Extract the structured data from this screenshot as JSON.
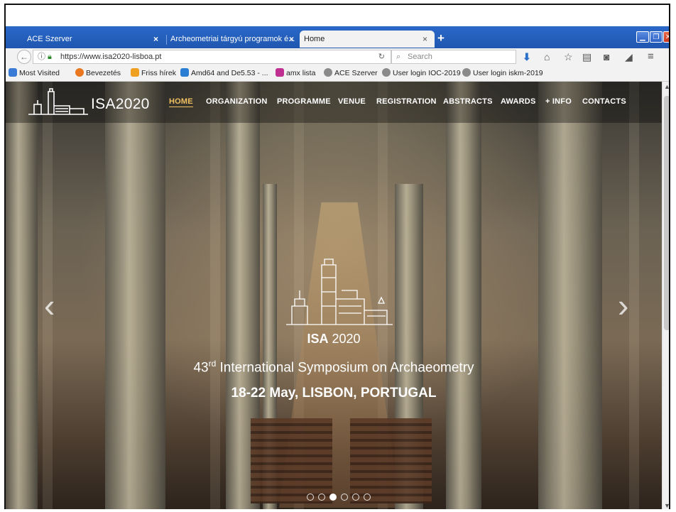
{
  "browser": {
    "tabs": [
      {
        "label": "ACE Szerver",
        "active": false
      },
      {
        "label": "Archeometriai tárgyú programok é...",
        "active": false
      },
      {
        "label": "Home",
        "active": true
      }
    ],
    "new_tab": "+",
    "close_glyph": "×",
    "url": "https://www.isa2020-lisboa.pt",
    "search_placeholder": "Search",
    "bookmarks": [
      {
        "label": "Most Visited",
        "icon": "most-visited-icon",
        "color": "#3a7bd5"
      },
      {
        "label": "Bevezetés",
        "icon": "firefox-icon",
        "color": "#e8771f"
      },
      {
        "label": "Friss hírek",
        "icon": "rss-icon",
        "color": "#f0a020"
      },
      {
        "label": "Amd64 and De5.53 - ...",
        "icon": "s-icon",
        "color": "#2a7fd4"
      },
      {
        "label": "amx lista",
        "icon": "amx-icon",
        "color": "#c03090"
      },
      {
        "label": "ACE Szerver",
        "icon": "globe-icon",
        "color": "#8a8a8a"
      },
      {
        "label": "User login IOC-2019",
        "icon": "globe-icon",
        "color": "#8a8a8a"
      },
      {
        "label": "User login iskm-2019",
        "icon": "globe-icon",
        "color": "#8a8a8a"
      }
    ]
  },
  "site": {
    "logo_text": "ISA2020",
    "menu": [
      "HOME",
      "ORGANIZATION",
      "PROGRAMME",
      "VENUE",
      "REGISTRATION",
      "ABSTRACTS",
      "AWARDS",
      "+ INFO",
      "CONTACTS"
    ],
    "slide": {
      "isa_bold": "ISA",
      "isa_year": " 2020",
      "subtitle_pre": "43",
      "subtitle_sup": "rd",
      "subtitle_post": " International Symposium on Archaeometry",
      "date": "18-22 May, LISBON, PORTUGAL"
    },
    "slider_dots": 6,
    "slider_active": 3,
    "prev_arrow": "‹",
    "next_arrow": "›"
  }
}
